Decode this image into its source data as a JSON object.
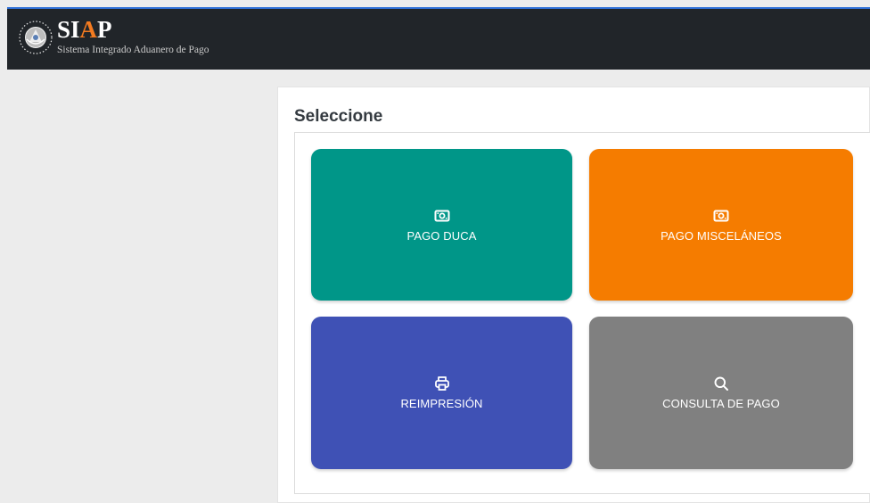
{
  "header": {
    "logo_part1": "SI",
    "logo_part2": "A",
    "logo_part3": "P",
    "tagline": "Sistema Integrado Aduanero de Pago",
    "accent_color": "#f47b20",
    "bar_color": "#212529",
    "top_line_color": "#2e6fd6"
  },
  "main": {
    "title": "Seleccione",
    "tiles": [
      {
        "label": "PAGO DUCA",
        "icon": "money-bill-icon",
        "color": "#009688"
      },
      {
        "label": "PAGO MISCELÁNEOS",
        "icon": "money-bill-icon",
        "color": "#f57c00"
      },
      {
        "label": "REIMPRESIÓN",
        "icon": "printer-icon",
        "color": "#3f51b5"
      },
      {
        "label": "CONSULTA DE PAGO",
        "icon": "search-icon",
        "color": "#808080"
      }
    ]
  }
}
